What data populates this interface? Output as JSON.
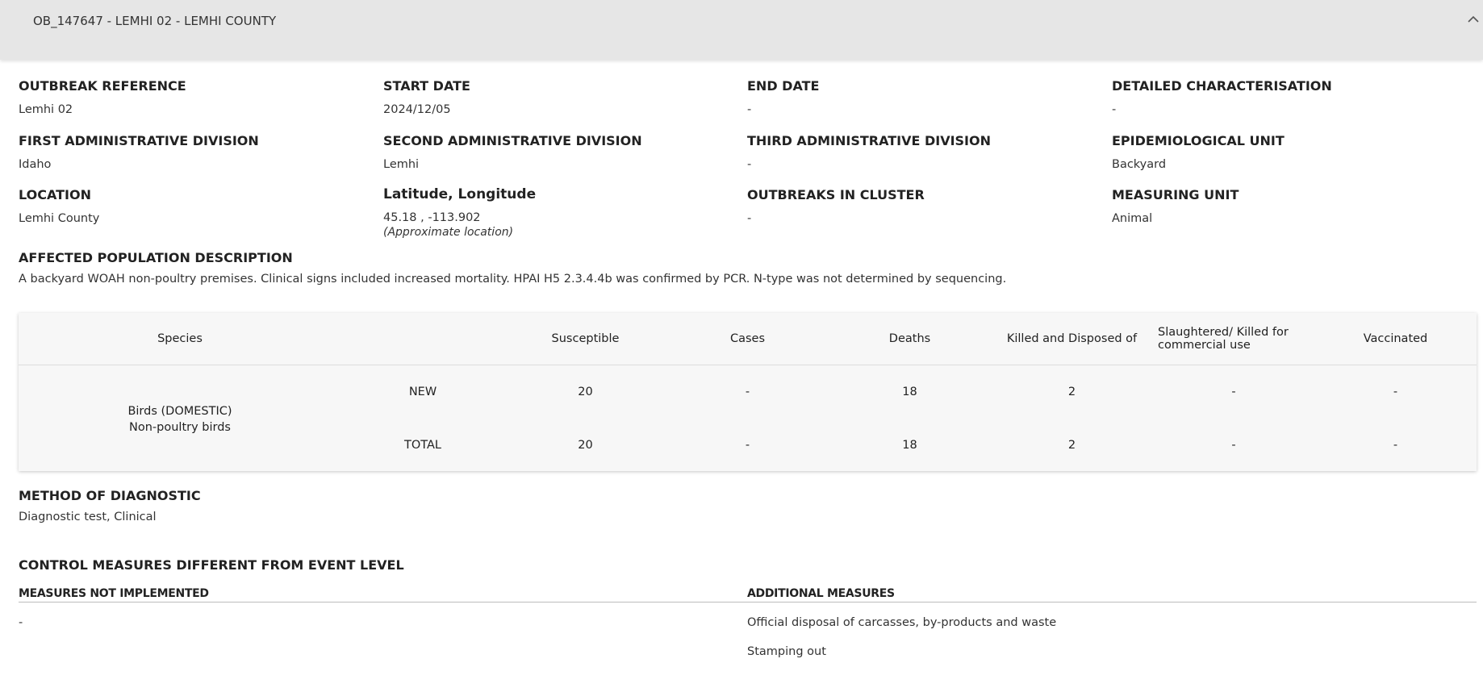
{
  "header": {
    "title": "OB_147647 - LEMHI 02 - LEMHI COUNTY"
  },
  "fields": {
    "outbreak_reference": {
      "label": "OUTBREAK REFERENCE",
      "value": "Lemhi 02"
    },
    "start_date": {
      "label": "START DATE",
      "value": "2024/12/05"
    },
    "end_date": {
      "label": "END DATE",
      "value": "-"
    },
    "detailed_characterisation": {
      "label": "DETAILED CHARACTERISATION",
      "value": "-"
    },
    "first_admin_division": {
      "label": "FIRST ADMINISTRATIVE DIVISION",
      "value": "Idaho"
    },
    "second_admin_division": {
      "label": "SECOND ADMINISTRATIVE DIVISION",
      "value": "Lemhi"
    },
    "third_admin_division": {
      "label": "THIRD ADMINISTRATIVE DIVISION",
      "value": "-"
    },
    "epidemiological_unit": {
      "label": "EPIDEMIOLOGICAL UNIT",
      "value": "Backyard"
    },
    "location": {
      "label": "LOCATION",
      "value": "Lemhi County"
    },
    "lat_long": {
      "label": "Latitude, Longitude",
      "value": "45.18 , -113.902",
      "note": "(Approximate location)"
    },
    "outbreaks_in_cluster": {
      "label": "OUTBREAKS IN CLUSTER",
      "value": "-"
    },
    "measuring_unit": {
      "label": "MEASURING UNIT",
      "value": "Animal"
    }
  },
  "affected_population": {
    "label": "AFFECTED POPULATION DESCRIPTION",
    "text": "A backyard WOAH non-poultry premises. Clinical signs included increased mortality. HPAI H5 2.3.4.4b was confirmed by PCR. N-type was not determined by sequencing."
  },
  "table": {
    "headers": {
      "species": "Species",
      "susceptible": "Susceptible",
      "cases": "Cases",
      "deaths": "Deaths",
      "killed": "Killed and Disposed of",
      "slaughtered": "Slaughtered/ Killed for commercial use",
      "vaccinated": "Vaccinated"
    },
    "species_line1": "Birds (DOMESTIC)",
    "species_line2": "Non-poultry birds",
    "rows": [
      {
        "type": "NEW",
        "susceptible": "20",
        "cases": "-",
        "deaths": "18",
        "killed": "2",
        "slaughtered": "-",
        "vaccinated": "-"
      },
      {
        "type": "TOTAL",
        "susceptible": "20",
        "cases": "-",
        "deaths": "18",
        "killed": "2",
        "slaughtered": "-",
        "vaccinated": "-"
      }
    ]
  },
  "method_of_diagnostic": {
    "label": "METHOD OF DIAGNOSTIC",
    "value": "Diagnostic test, Clinical"
  },
  "control_measures": {
    "label": "CONTROL MEASURES DIFFERENT FROM EVENT LEVEL",
    "not_implemented_label": "MEASURES NOT IMPLEMENTED",
    "not_implemented": [
      "-"
    ],
    "additional_label": "ADDITIONAL MEASURES",
    "additional": [
      "Official disposal of carcasses, by-products and waste",
      "Stamping out"
    ]
  },
  "icons": {
    "collapse": "chevron-up-icon"
  }
}
